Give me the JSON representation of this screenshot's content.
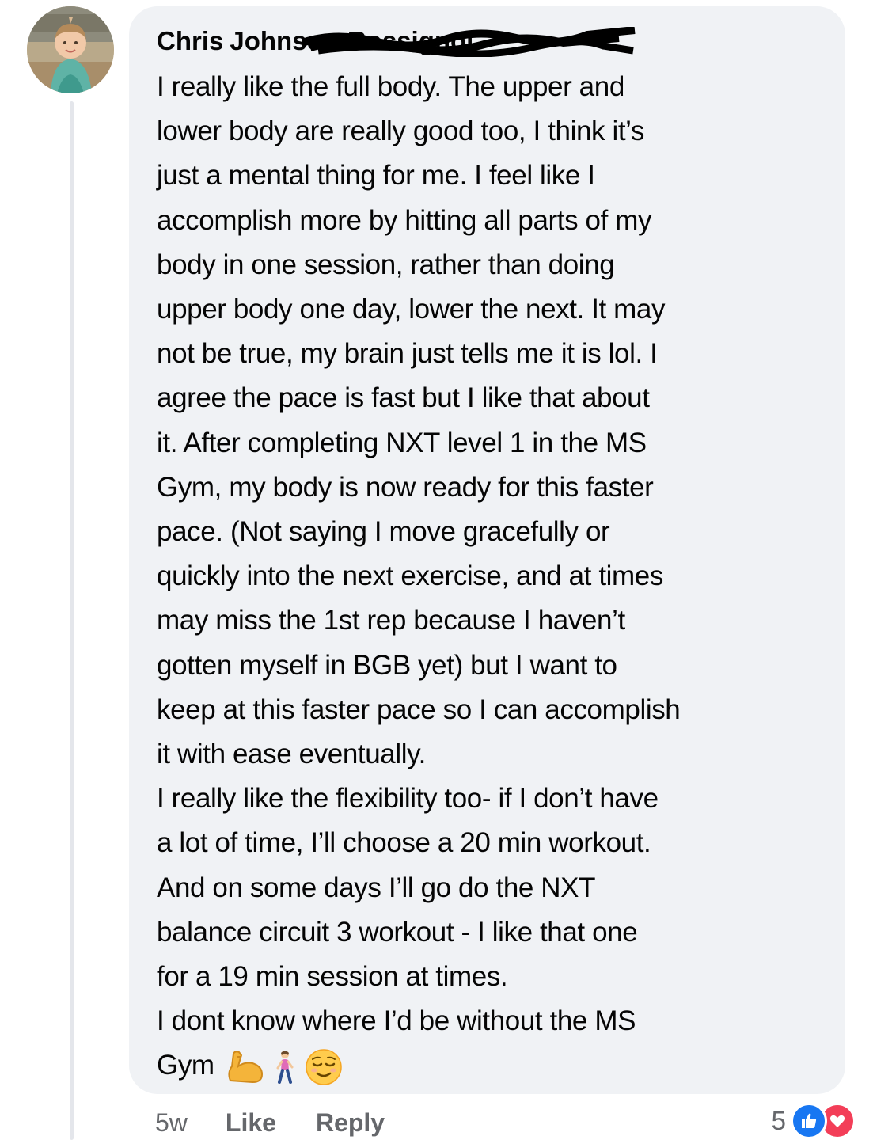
{
  "comment": {
    "author_first": "Chris",
    "author_last": "Johnson-Rossignol",
    "avatar_icon": "profile-photo-child",
    "lines": [
      "I really like the full body.  The upper and",
      "lower body are really good too, I think it’s",
      "just a mental thing for me.  I feel like I",
      "accomplish more by hitting all parts of my",
      "body in one session, rather than doing",
      "upper body one day, lower the next.  It may",
      "not be true, my brain just tells me it is lol. I",
      "agree the pace is fast but I like that about",
      "it.  After completing NXT level 1 in the MS",
      "Gym, my body is now ready for this faster",
      "pace. (Not saying I move gracefully or",
      "quickly into the next exercise, and at times",
      "may miss the 1st rep because I haven’t",
      "gotten myself in BGB yet) but I want to",
      "keep at this faster pace so I can accomplish",
      "it with ease eventually.",
      "I really like the flexibility too-  if I don’t have",
      "a lot of time,  I’ll choose a 20 min workout.",
      "And on some days I’ll go do the NXT",
      "balance circuit 3 workout - I like that one",
      "for a 19 min session at times.",
      "I dont know where I’d be without the MS"
    ],
    "last_line": "Gym",
    "emojis": [
      "flexed-biceps-icon",
      "woman-walking-icon",
      "relieved-face-icon"
    ]
  },
  "footer": {
    "time": "5w",
    "like_label": "Like",
    "reply_label": "Reply"
  },
  "reactions": {
    "count": "5",
    "types": [
      "like-reaction-icon",
      "love-reaction-icon"
    ],
    "colors": {
      "like": "#1877f2",
      "love": "#f33e58"
    }
  },
  "colors": {
    "bubble": "#f0f2f5",
    "text": "#050505",
    "secondary": "#65676b",
    "thread_line": "#e4e6eb"
  }
}
